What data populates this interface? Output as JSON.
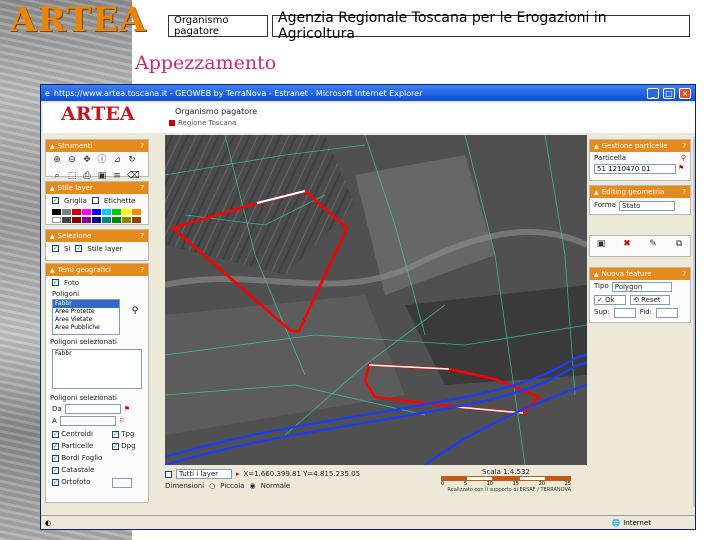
{
  "slide": {
    "logo": "ARTEA",
    "org_label": "Organismo pagatore",
    "agency": "Agenzia Regionale Toscana per le Erogazioni in Agricoltura",
    "title": "Appezzamento"
  },
  "window": {
    "title": "https://www.artea.toscana.it - GEOWEB by TerraNova - Estranet - Microsoft Internet Explorer",
    "min": "_",
    "max": "□",
    "close": "×"
  },
  "app": {
    "logo": "ARTEA",
    "org": "Organismo pagatore",
    "region": "Regione Toscana"
  },
  "left_panels": {
    "strumenti": "Strumenti",
    "stile": "Stile layer",
    "stile_opts": [
      "Griglia",
      "Etichette"
    ],
    "selezione": "Selezione",
    "selezione_opts": [
      "Sì",
      "Stile layer"
    ],
    "temi": "Temi geografici",
    "temi_opts": [
      "Foto"
    ],
    "temi_label": "Poligoni",
    "temi_items": [
      "Fabbr",
      "Aree Protette",
      "Aree Vietate",
      "Aree Pubbliche"
    ],
    "poligoni_label": "Poligoni selezionati",
    "poligoni_items": [
      "Fabbr"
    ],
    "poligoni_sel_label": "Poligoni selezionati",
    "row_da": "Da",
    "row_a": "A",
    "checks": [
      "Centroidi",
      "Particelle",
      "Bordi Foglio",
      "Catastale",
      "Ortofoto"
    ],
    "checks2": [
      "Tpg",
      "Dpg"
    ]
  },
  "right_panels": {
    "gestione": "Gestione particelle",
    "particella_label": "Particella",
    "particella_value": "51 1210470 01",
    "editing": "Editing geometria",
    "forma_label": "Forma",
    "forma_value": "Stato",
    "nuova": "Nuova feature",
    "tipo_label": "Tipo",
    "tipo_value": "Polygon",
    "btn1": "Ok",
    "btn2": "Reset",
    "sup_label": "Sup:",
    "fid_label": "Fid:"
  },
  "map_footer": {
    "select_label": "Tutti i layer",
    "coords": "X=1.660.399.81  Y=4.815.235.05",
    "dimensioni": "Dimensioni",
    "opt1": "Piccola",
    "opt2": "Normale",
    "scale_text": "Scala 1:4.532",
    "scale_ticks": [
      "0",
      "5",
      "10",
      "15",
      "20",
      "25"
    ],
    "credit": "Realizzato con il supporto di ERSAF / TERRANOVA"
  },
  "statusbar": {
    "text": "Internet"
  },
  "colors": {
    "accent_orange": "#e58a1c",
    "selection_red": "#ff0000",
    "road_blue": "#1a3cff",
    "title_pink": "#cc2a6c"
  }
}
